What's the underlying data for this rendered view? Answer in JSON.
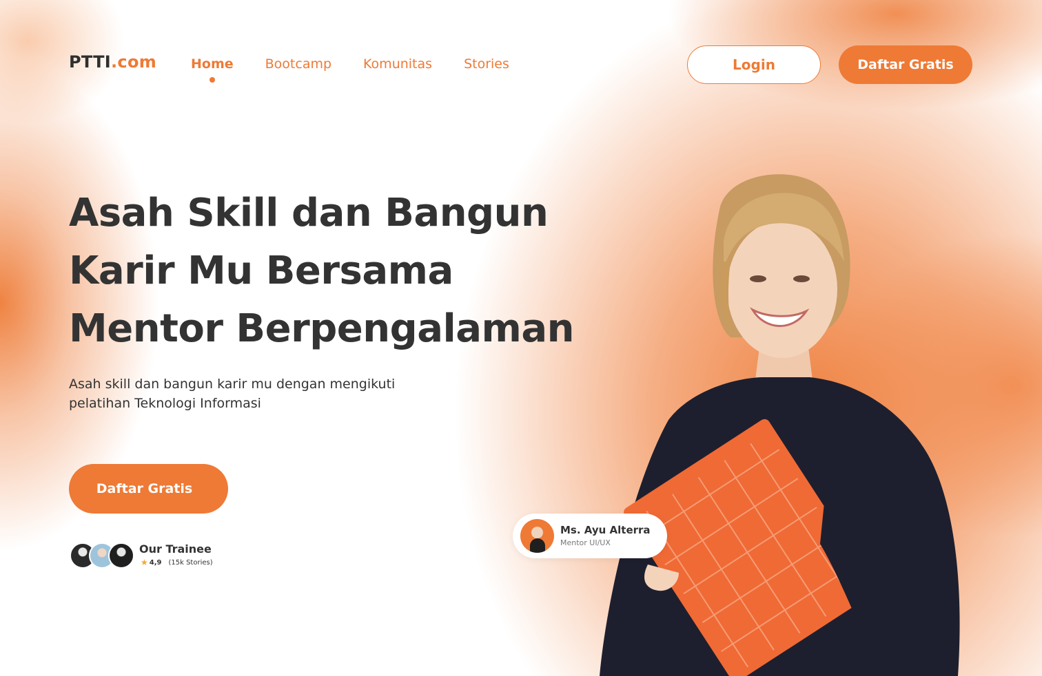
{
  "brand": {
    "name_part1": "PTTI",
    "name_part2": ".com",
    "accent_color": "#ee7a35",
    "text_dark": "#333333"
  },
  "nav": {
    "items": [
      {
        "label": "Home",
        "active": true
      },
      {
        "label": "Bootcamp",
        "active": false
      },
      {
        "label": "Komunitas",
        "active": false
      },
      {
        "label": "Stories",
        "active": false
      }
    ],
    "login_label": "Login",
    "signup_label": "Daftar Gratis"
  },
  "hero": {
    "title_lines": [
      "Asah Skill dan Bangun",
      "Karir Mu Bersama",
      "Mentor Berpengalaman"
    ],
    "subtitle_lines": [
      "Asah skill dan bangun karir mu dengan mengikuti",
      "pelatihan Teknologi Informasi"
    ],
    "cta_label": "Daftar Gratis"
  },
  "trainee": {
    "title": "Our Trainee",
    "rating": "4,9",
    "stories": "(15k Stories)",
    "star_icon": "star-icon"
  },
  "mentor_card": {
    "name": "Ms. Ayu Alterra",
    "role": "Mentor UI/UX"
  }
}
